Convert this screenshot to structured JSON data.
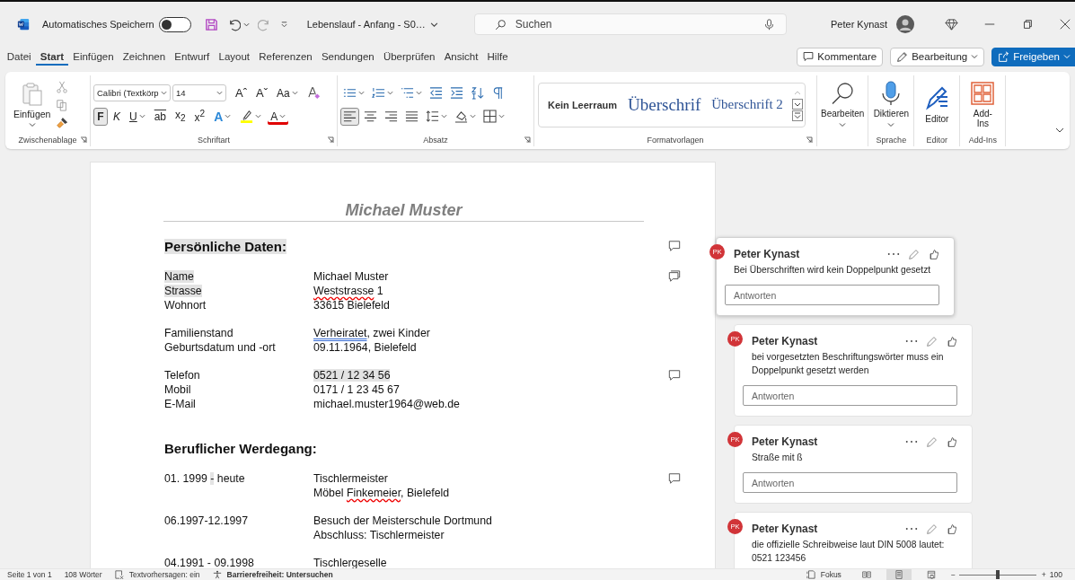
{
  "title_bar": {
    "autosave_label": "Automatisches Speichern",
    "autosave_on": false,
    "document_title": "Lebenslauf - Anfang - S0…",
    "search_placeholder": "Suchen",
    "user_name": "Peter Kynast"
  },
  "menu_tabs": [
    {
      "label": "Datei",
      "selected": false
    },
    {
      "label": "Start",
      "selected": true
    },
    {
      "label": "Einfügen",
      "selected": false
    },
    {
      "label": "Zeichnen",
      "selected": false
    },
    {
      "label": "Entwurf",
      "selected": false
    },
    {
      "label": "Layout",
      "selected": false
    },
    {
      "label": "Referenzen",
      "selected": false
    },
    {
      "label": "Sendungen",
      "selected": false
    },
    {
      "label": "Überprüfen",
      "selected": false
    },
    {
      "label": "Ansicht",
      "selected": false
    },
    {
      "label": "Hilfe",
      "selected": false
    }
  ],
  "menu_actions": [
    {
      "label": "Kommentare",
      "kind": "comments"
    },
    {
      "label": "Bearbeitung",
      "kind": "editing"
    },
    {
      "label": "Freigeben",
      "kind": "share"
    }
  ],
  "ribbon": {
    "clipboard": {
      "label": "Zwischenablage",
      "paste_label": "Einfügen"
    },
    "font": {
      "label": "Schriftart",
      "font_name": "Calibri (Textkörp",
      "font_size": "14",
      "top_buttons": [
        {
          "text": "Aˆ",
          "kind": "grow",
          "dropdown": false
        },
        {
          "text": "Aˇ",
          "kind": "shrink",
          "dropdown": false
        },
        {
          "text": "Aa",
          "kind": "case",
          "dropdown": true
        },
        {
          "kind": "clear"
        }
      ],
      "bottom_buttons": [
        {
          "text": "F",
          "kind": "bold",
          "selected": true,
          "dropdown": false
        },
        {
          "text": "K",
          "kind": "italic",
          "selected": false,
          "dropdown": false
        },
        {
          "text": "U",
          "kind": "underline",
          "selected": false,
          "dropdown": true
        },
        {
          "text": "ab",
          "kind": "strike",
          "selected": false,
          "dropdown": false
        },
        {
          "text": "x$_{2}$",
          "kind": "sub",
          "selected": false,
          "dropdown": false
        },
        {
          "text": "x$^{2}$",
          "kind": "sup",
          "selected": false,
          "dropdown": false
        },
        {
          "text": "A",
          "kind": "effect",
          "selected": false,
          "dropdown": true
        },
        {
          "kind": "highlight",
          "selected": false,
          "dropdown": true
        },
        {
          "text": "A",
          "kind": "color",
          "selected": false,
          "dropdown": true
        }
      ]
    },
    "paragraph": {
      "label": "Absatz",
      "top_buttons": [
        {
          "kind": "bullets",
          "dropdown": true
        },
        {
          "kind": "numbering",
          "dropdown": true
        },
        {
          "kind": "multilevel",
          "dropdown": true
        },
        {
          "kind": "outdent",
          "dropdown": false
        },
        {
          "kind": "indent",
          "dropdown": false
        },
        {
          "kind": "sort",
          "dropdown": false
        },
        {
          "kind": "pilcrow",
          "dropdown": false
        }
      ],
      "bottom_buttons": [
        {
          "kind": "align-left",
          "selected": true,
          "dropdown": false
        },
        {
          "kind": "align-center",
          "selected": false,
          "dropdown": false
        },
        {
          "kind": "align-right",
          "selected": false,
          "dropdown": false
        },
        {
          "kind": "justify",
          "selected": false,
          "dropdown": false
        },
        {
          "kind": "line-spacing",
          "selected": false,
          "dropdown": true
        },
        {
          "kind": "shading",
          "selected": false,
          "dropdown": true
        },
        {
          "kind": "borders",
          "selected": false,
          "dropdown": true
        }
      ]
    },
    "styles": {
      "label": "Formatvorlagen",
      "items": [
        {
          "label": "Kein Leerraum",
          "kind": "plain"
        },
        {
          "label": "Überschrif",
          "kind": "heading1"
        },
        {
          "label": "Überschrift 2",
          "kind": "heading2"
        }
      ]
    },
    "tools": [
      {
        "label": "Bearbeiten",
        "kind": "find",
        "dropdown": true
      },
      {
        "label": "Diktieren",
        "kind": "dictate",
        "dropdown": true,
        "group": "Sprache"
      },
      {
        "label": "Editor",
        "kind": "editor",
        "dropdown": false,
        "group": "Editor"
      },
      {
        "label": "Add-Ins",
        "kind": "addins",
        "dropdown": false,
        "group": "Add-Ins"
      }
    ]
  },
  "document": {
    "title": "Michael Muster",
    "sections": [
      {
        "heading": "Persönliche Daten:",
        "heading_highlighted": true,
        "has_comment": true,
        "groups": [
          {
            "rows": [
              {
                "label": [
                  {
                    "text": "Name",
                    "highlighted": true
                  }
                ],
                "value": [
                  {
                    "text": "Michael Muster"
                  }
                ],
                "has_comment": true,
                "multiple_comments": true
              },
              {
                "label": [
                  {
                    "text": "Strasse",
                    "highlighted": true
                  }
                ],
                "value": [
                  {
                    "text": "Weststrasse",
                    "misspelled": true
                  },
                  {
                    "text": " 1"
                  }
                ]
              },
              {
                "label": [
                  {
                    "text": "Wohnort"
                  }
                ],
                "value": [
                  {
                    "text": "33615 Bielefeld"
                  }
                ]
              }
            ]
          },
          {
            "rows": [
              {
                "label": [
                  {
                    "text": "Familienstand"
                  }
                ],
                "value": [
                  {
                    "text": "Verheiratet",
                    "grammar_flag": true
                  },
                  {
                    "text": ", zwei Kinder"
                  }
                ]
              },
              {
                "label": [
                  {
                    "text": "Geburtsdatum und -ort"
                  }
                ],
                "value": [
                  {
                    "text": "09.11.1964, Bielefeld"
                  }
                ]
              }
            ]
          },
          {
            "rows": [
              {
                "label": [
                  {
                    "text": "Telefon"
                  }
                ],
                "value": [
                  {
                    "text": "0521 / 12 34 56",
                    "highlighted": true
                  }
                ],
                "has_comment": true
              },
              {
                "label": [
                  {
                    "text": "Mobil"
                  }
                ],
                "value": [
                  {
                    "text": "0171 / 1 23 45 67"
                  }
                ]
              },
              {
                "label": [
                  {
                    "text": "E-Mail"
                  }
                ],
                "value": [
                  {
                    "text": "michael.muster1964@web.de"
                  }
                ]
              }
            ]
          }
        ]
      },
      {
        "heading": "Beruflicher Werdegang:",
        "heading_highlighted": false,
        "groups": [
          {
            "rows": [
              {
                "label": [
                  {
                    "text": "01. 1999 "
                  },
                  {
                    "text": "-",
                    "highlighted": true
                  },
                  {
                    "text": " heute"
                  }
                ],
                "value": [
                  {
                    "text": "Tischlermeister"
                  }
                ],
                "has_comment": true
              },
              {
                "value": [
                  {
                    "text": "Möbel "
                  },
                  {
                    "text": "Finkemeier",
                    "misspelled": true
                  },
                  {
                    "text": ", Bielefeld"
                  }
                ]
              }
            ]
          },
          {
            "rows": [
              {
                "label": [
                  {
                    "text": "06.1997-12.1997"
                  }
                ],
                "value": [
                  {
                    "text": "Besuch der Meisterschule Dortmund"
                  }
                ]
              },
              {
                "value": [
                  {
                    "text": "Abschluss: Tischlermeister"
                  }
                ]
              }
            ]
          },
          {
            "rows": [
              {
                "label": [
                  {
                    "text": "04.1991 - 09.1998"
                  }
                ],
                "value": [
                  {
                    "text": "Tischlergeselle"
                  }
                ]
              }
            ]
          }
        ]
      }
    ]
  },
  "comments": [
    {
      "author": "Peter Kynast",
      "initials": "PK",
      "text": "Bei Überschriften wird kein Doppelpunkt gesetzt",
      "reply_placeholder": "Antworten",
      "selected": true
    },
    {
      "author": "Peter Kynast",
      "initials": "PK",
      "text": "bei vorgesetzten Beschriftungswörter muss ein Doppelpunkt gesetzt werden",
      "reply_placeholder": "Antworten",
      "selected": false
    },
    {
      "author": "Peter Kynast",
      "initials": "PK",
      "text": "Straße mit ß",
      "reply_placeholder": "Antworten",
      "selected": false
    },
    {
      "author": "Peter Kynast",
      "initials": "PK",
      "text": "die offizielle Schreibweise laut DIN 5008 lautet: 0521 123456",
      "selected": false
    }
  ],
  "status_bar": {
    "page": "Seite 1 von 1",
    "words": "108 Wörter",
    "prediction": "Textvorhersagen: ein",
    "accessibility": "Barrierefreiheit: Untersuchen",
    "focus": "Fokus",
    "views": [
      {
        "kind": "read",
        "selected": false
      },
      {
        "kind": "print",
        "selected": true
      },
      {
        "kind": "web",
        "selected": false
      }
    ],
    "zoom": {
      "minus": "−",
      "level": 0.5,
      "plus": "+",
      "value": "100"
    }
  }
}
